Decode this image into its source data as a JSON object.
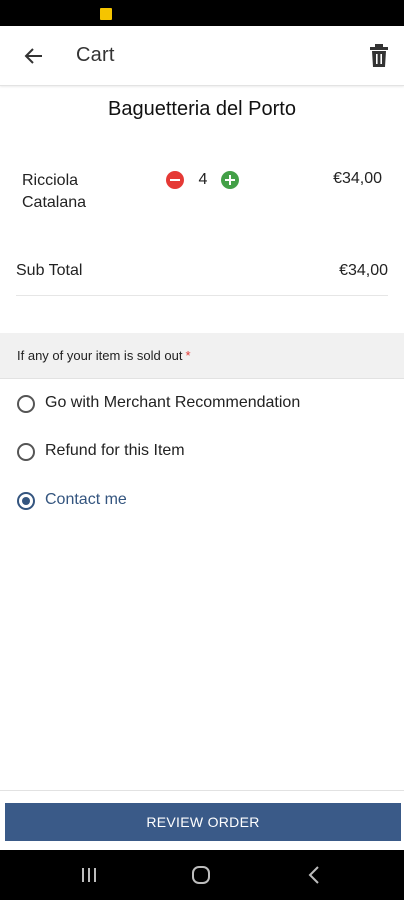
{
  "app_bar": {
    "title": "Cart",
    "back_icon": "arrow-left-icon",
    "delete_icon": "trash-icon"
  },
  "store": {
    "name": "Baguetteria del Porto"
  },
  "cart": {
    "items": [
      {
        "name": "Ricciola Catalana",
        "quantity": "4",
        "price": "€34,00"
      }
    ],
    "subtotal_label": "Sub Total",
    "subtotal_value": "€34,00"
  },
  "sold_out": {
    "prompt": "If any of your item is sold out",
    "required_marker": "*",
    "options": [
      {
        "label": "Go with Merchant Recommendation",
        "selected": false
      },
      {
        "label": "Refund for this Item",
        "selected": false
      },
      {
        "label": "Contact me",
        "selected": true
      }
    ]
  },
  "actions": {
    "review_order": "REVIEW ORDER"
  },
  "colors": {
    "primary": "#3a5a88",
    "minus": "#e53935",
    "plus": "#43a047",
    "required": "#e53935",
    "status_indicator": "#f5c400"
  }
}
